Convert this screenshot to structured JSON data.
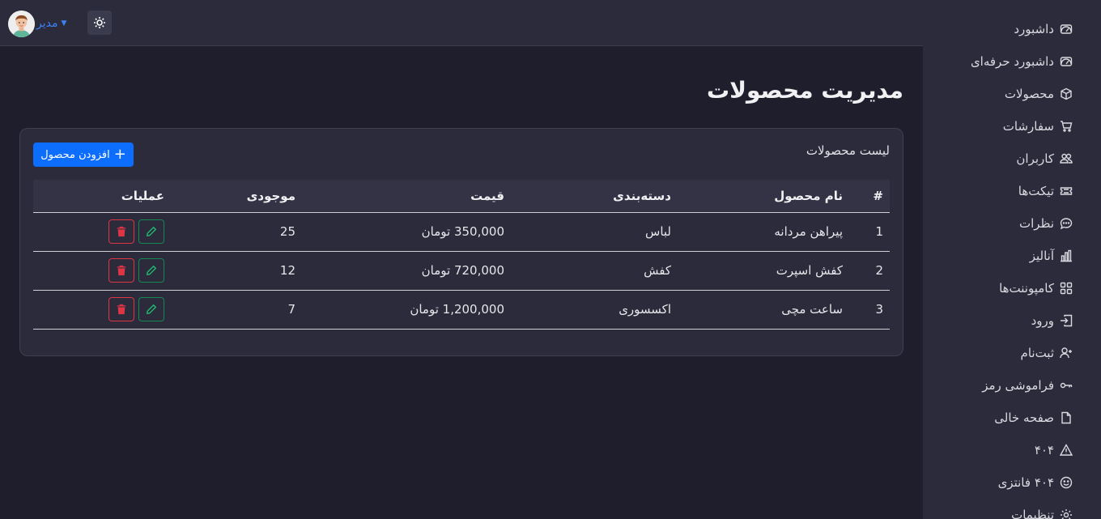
{
  "sidebar": {
    "items": [
      {
        "label": "داشبورد",
        "icon": "speedometer-icon"
      },
      {
        "label": "داشبورد حرفه‌ای",
        "icon": "speedometer-icon"
      },
      {
        "label": "محصولات",
        "icon": "box-icon"
      },
      {
        "label": "سفارشات",
        "icon": "cart-icon"
      },
      {
        "label": "کاربران",
        "icon": "users-icon"
      },
      {
        "label": "تیکت‌ها",
        "icon": "ticket-icon"
      },
      {
        "label": "نظرات",
        "icon": "chat-icon"
      },
      {
        "label": "آنالیز",
        "icon": "bar-chart-icon"
      },
      {
        "label": "کامپوننت‌ها",
        "icon": "grid-icon"
      },
      {
        "label": "ورود",
        "icon": "login-icon"
      },
      {
        "label": "ثبت‌نام",
        "icon": "user-plus-icon"
      },
      {
        "label": "فراموشی رمز",
        "icon": "key-icon"
      },
      {
        "label": "صفحه خالی",
        "icon": "file-icon"
      },
      {
        "label": "۴۰۴",
        "icon": "warning-icon"
      },
      {
        "label": "۴۰۴ فانتزی",
        "icon": "smile-icon"
      },
      {
        "label": "تنظیمات",
        "icon": "gear-icon"
      }
    ]
  },
  "topbar": {
    "user_name": "مدیر",
    "theme_icon": "sun-icon"
  },
  "main": {
    "title": "مدیریت محصولات",
    "card_title": "لیست محصولات",
    "add_button": "افزودن محصول",
    "columns": [
      "#",
      "نام محصول",
      "دسته‌بندی",
      "قیمت",
      "موجودی",
      "عملیات"
    ],
    "rows": [
      {
        "num": "1",
        "name": "پیراهن مردانه",
        "category": "لباس",
        "price": "350,000 تومان",
        "stock": "25"
      },
      {
        "num": "2",
        "name": "کفش اسپرت",
        "category": "کفش",
        "price": "720,000 تومان",
        "stock": "12"
      },
      {
        "num": "3",
        "name": "ساعت مچی",
        "category": "اکسسوری",
        "price": "1,200,000 تومان",
        "stock": "7"
      }
    ]
  },
  "colors": {
    "accent": "#0d6efd",
    "edit": "#198754",
    "delete": "#dc3545",
    "background": "#1f1e2d",
    "panel": "#2b2b3b"
  }
}
